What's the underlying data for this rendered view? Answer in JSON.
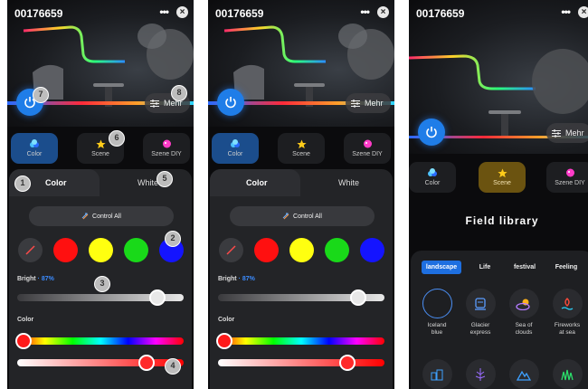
{
  "header": {
    "device_id": "00176659",
    "more_glyph": "•••",
    "close_glyph": "×"
  },
  "hero": {
    "mehr_label": "Mehr"
  },
  "modes": [
    {
      "label": "Color",
      "icon": "color-dots-icon"
    },
    {
      "label": "Scene",
      "icon": "star-icon"
    },
    {
      "label": "Szene DIY",
      "icon": "palette-icon"
    }
  ],
  "color_panel": {
    "tab_color": "Color",
    "tab_white": "White",
    "control_all": "Control All",
    "bright_label": "Bright",
    "bright_separator": " · ",
    "bright_value": "87%",
    "color_label": "Color",
    "swatches": [
      "off",
      "#ff1010",
      "#ffff10",
      "#19d919",
      "#1414ff"
    ],
    "brightness_fraction": 0.87,
    "hue_fraction": 0.0,
    "saturation_fraction": 0.79
  },
  "badges": [
    "1",
    "2",
    "3",
    "4",
    "5",
    "6",
    "7",
    "8"
  ],
  "scene_library": {
    "title": "Field library",
    "categories": [
      "landscape",
      "Life",
      "festival",
      "Feeling"
    ],
    "tiles": [
      {
        "label_line1": "Iceland",
        "label_line2": "blue",
        "icon": "ring-icon"
      },
      {
        "label_line1": "Glacier",
        "label_line2": "express",
        "icon": "train-icon"
      },
      {
        "label_line1": "Sea of",
        "label_line2": "clouds",
        "icon": "cloud-sun-icon"
      },
      {
        "label_line1": "Fireworks",
        "label_line2": "at sea",
        "icon": "fireworks-icon"
      }
    ],
    "more_tiles_icons": [
      "city-icon",
      "tree-icon",
      "mountain-icon",
      "grass-icon"
    ]
  },
  "colors": {
    "accent_blue": "#1f7de8",
    "pct_blue": "#3b8cff",
    "gold": "#6b5310"
  }
}
